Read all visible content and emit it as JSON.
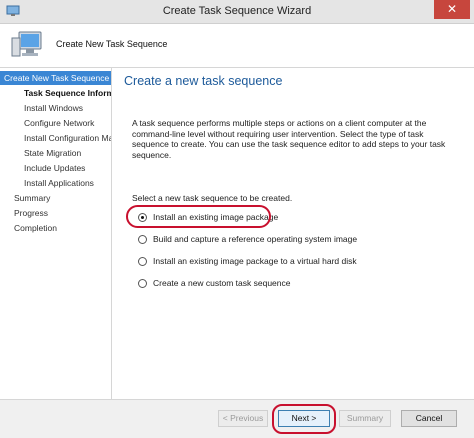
{
  "window": {
    "title": "Create Task Sequence Wizard",
    "close_glyph": "✕"
  },
  "header": {
    "title": "Create New Task Sequence"
  },
  "sidebar": {
    "items": [
      {
        "label": "Create New Task Sequence",
        "state": "selected"
      },
      {
        "label": "Task Sequence Information",
        "state": "current"
      },
      {
        "label": "Install Windows",
        "state": "sub"
      },
      {
        "label": "Configure Network",
        "state": "sub"
      },
      {
        "label": "Install Configuration Manager",
        "state": "sub"
      },
      {
        "label": "State Migration",
        "state": "sub"
      },
      {
        "label": "Include Updates",
        "state": "sub"
      },
      {
        "label": "Install Applications",
        "state": "sub"
      },
      {
        "label": "Summary",
        "state": "top"
      },
      {
        "label": "Progress",
        "state": "top"
      },
      {
        "label": "Completion",
        "state": "top"
      }
    ]
  },
  "main": {
    "page_title": "Create a new task sequence",
    "description": "A task sequence performs multiple steps or actions on a client computer at the command-line level without requiring user intervention. Select the type of task sequence to create. You can use the task sequence editor to add steps to your task sequence.",
    "select_label": "Select a new task sequence to be created.",
    "options": [
      {
        "label": "Install an existing image package",
        "checked": true
      },
      {
        "label": "Build and capture a reference operating system image",
        "checked": false
      },
      {
        "label": "Install an existing image package to a virtual hard disk",
        "checked": false
      },
      {
        "label": "Create a new custom task sequence",
        "checked": false
      }
    ]
  },
  "footer": {
    "previous_label": "< Previous",
    "next_label": "Next >",
    "summary_label": "Summary",
    "cancel_label": "Cancel"
  },
  "colors": {
    "accent": "#3a86d4",
    "title_blue": "#1d5a9a",
    "highlight_red": "#c8102e",
    "close_red": "#c7463d"
  }
}
